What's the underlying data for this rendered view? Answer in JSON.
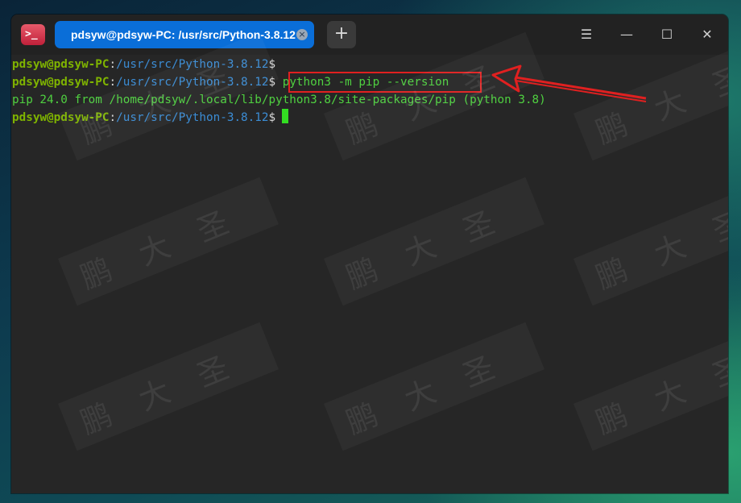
{
  "titlebar": {
    "tab_title": "pdsyw@pdsyw-PC: /usr/src/Python-3.8.12",
    "tab_close_symbol": "×",
    "new_tab_symbol": "+",
    "menu_symbol": "☰",
    "minimize_symbol": "—",
    "maximize_symbol": "☐",
    "close_symbol": "✕"
  },
  "terminal": {
    "lines": [
      {
        "user": "pdsyw@pdsyw-PC",
        "colon": ":",
        "path": "/usr/src/Python-3.8.12",
        "dollar": "$",
        "command": ""
      },
      {
        "user": "pdsyw@pdsyw-PC",
        "colon": ":",
        "path": "/usr/src/Python-3.8.12",
        "dollar": "$",
        "command": "python3 -m pip --version"
      },
      {
        "output": "pip 24.0 from /home/pdsyw/.local/lib/python3.8/site-packages/pip (python 3.8)"
      },
      {
        "user": "pdsyw@pdsyw-PC",
        "colon": ":",
        "path": "/usr/src/Python-3.8.12",
        "dollar": "$",
        "command": ""
      }
    ]
  },
  "watermark": {
    "text": "鹏大圣"
  },
  "colors": {
    "user": "#7fb400",
    "path": "#3b8cd4",
    "command": "#4fd040",
    "annotation": "#e02020",
    "tab_active": "#0a6ed8"
  }
}
